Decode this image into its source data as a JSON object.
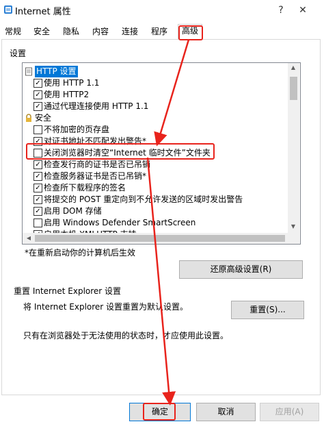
{
  "window": {
    "title": "Internet 属性",
    "help": "?",
    "close": "✕"
  },
  "tabs": [
    "常规",
    "安全",
    "隐私",
    "内容",
    "连接",
    "程序",
    "高级"
  ],
  "settings": {
    "label": "设置",
    "rows": [
      {
        "type": "group",
        "icon": "page-icon",
        "text": "HTTP 设置",
        "selected": true
      },
      {
        "type": "check",
        "checked": true,
        "text": "使用 HTTP 1.1"
      },
      {
        "type": "check",
        "checked": true,
        "text": "使用 HTTP2"
      },
      {
        "type": "check",
        "checked": true,
        "text": "通过代理连接使用 HTTP 1.1"
      },
      {
        "type": "group",
        "icon": "lock-icon",
        "text": "安全"
      },
      {
        "type": "check",
        "checked": false,
        "text": "不将加密的页存盘"
      },
      {
        "type": "check",
        "checked": true,
        "text": "对证书地址不匹配发出警告*"
      },
      {
        "type": "check",
        "checked": false,
        "text": "关闭浏览器时清空“Internet 临时文件”文件夹"
      },
      {
        "type": "check",
        "checked": true,
        "text": "检查发行商的证书是否已吊销"
      },
      {
        "type": "check",
        "checked": true,
        "text": "检查服务器证书是否已吊销*"
      },
      {
        "type": "check",
        "checked": true,
        "text": "检查所下载程序的签名"
      },
      {
        "type": "check",
        "checked": true,
        "text": "将提交的 POST 重定向到不允许发送的区域时发出警告"
      },
      {
        "type": "check",
        "checked": true,
        "text": "启用 DOM 存储"
      },
      {
        "type": "check",
        "checked": false,
        "text": "启用 Windows Defender SmartScreen"
      },
      {
        "type": "check",
        "checked": true,
        "text": "启用本机 XMLHTTP 支持"
      }
    ],
    "restart_note": "*在重新启动你的计算机后生效",
    "restore_button": "还原高级设置(R)"
  },
  "reset": {
    "heading": "重置 Internet Explorer 设置",
    "description": "将 Internet Explorer 设置重置为默认设置。",
    "button": "重置(S)...",
    "warning": "只有在浏览器处于无法使用的状态时，才应使用此设置。"
  },
  "footer": {
    "ok": "确定",
    "cancel": "取消",
    "apply": "应用(A)"
  },
  "colors": {
    "annotation": "#e8231c",
    "selection": "#0078d7"
  }
}
